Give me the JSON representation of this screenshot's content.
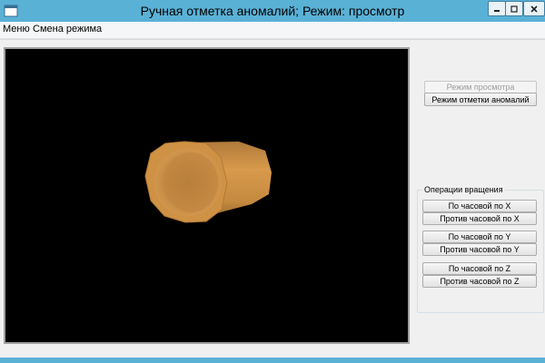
{
  "window": {
    "title": "Ручная отметка аномалий; Режим: просмотр"
  },
  "menu": {
    "items": [
      "Меню",
      "Смена режима"
    ]
  },
  "mode_buttons": {
    "view_label": "Режим просмотра",
    "view_enabled": false,
    "anomaly_label": "Режим отметки аномалий",
    "anomaly_enabled": true
  },
  "rotation": {
    "group_title": "Операции вращения",
    "buttons": [
      "По часовой по X",
      "Против часовой по X",
      "По часовой по Y",
      "Против часовой по Y",
      "По часовой по Z",
      "Против часовой по Z"
    ]
  },
  "viewport": {
    "background": "#000000",
    "object": "pipe",
    "object_color": "#c98a3f"
  },
  "colors": {
    "title_bar": "#5ab1d6",
    "client": "#f0f0f0"
  }
}
